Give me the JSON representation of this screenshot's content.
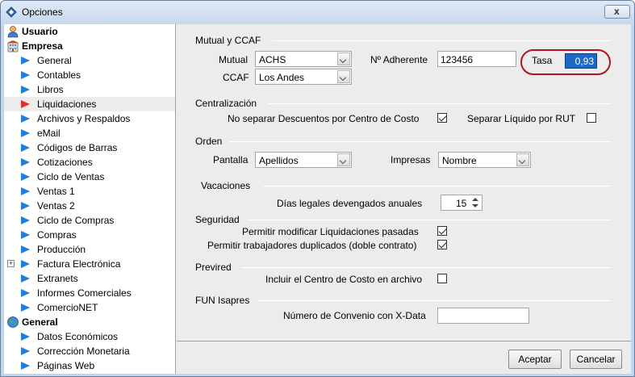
{
  "window": {
    "title": "Opciones",
    "close_label": "x"
  },
  "sidebar": {
    "usuario": "Usuario",
    "empresa": "Empresa",
    "empresa_items": [
      "General",
      "Contables",
      "Libros",
      "Liquidaciones",
      "Archivos y Respaldos",
      "eMail",
      "Códigos de Barras",
      "Cotizaciones",
      "Ciclo de Ventas",
      "Ventas 1",
      "Ventas 2",
      "Ciclo de Compras",
      "Compras",
      "Producción",
      "Factura Electrónica",
      "Extranets",
      "Informes Comerciales",
      "ComercioNET"
    ],
    "general": "General",
    "general_items": [
      "Datos Económicos",
      "Corrección Monetaria",
      "Páginas Web"
    ],
    "selected": "Liquidaciones",
    "expand_symbol": "+"
  },
  "mutual_ccaf": {
    "section": "Mutual y CCAF",
    "mutual_label": "Mutual",
    "mutual_value": "ACHS",
    "ccaf_label": "CCAF",
    "ccaf_value": "Los Andes",
    "adherente_label": "Nº Adherente",
    "adherente_value": "123456",
    "tasa_label": "Tasa",
    "tasa_value": "0,93"
  },
  "centralizacion": {
    "section": "Centralización",
    "no_separar_label": "No separar Descuentos por Centro de Costo",
    "no_separar_checked": true,
    "separar_rut_label": "Separar Líquido por RUT",
    "separar_rut_checked": false
  },
  "orden": {
    "section": "Orden",
    "pantalla_label": "Pantalla",
    "pantalla_value": "Apellidos",
    "impresas_label": "Impresas",
    "impresas_value": "Nombre"
  },
  "vacaciones": {
    "section": "Vacaciones",
    "dias_label": "Días legales devengados anuales",
    "dias_value": "15"
  },
  "seguridad": {
    "section": "Seguridad",
    "permitir_modificar_label": "Permitir modificar Liquidaciones pasadas",
    "permitir_modificar_checked": true,
    "permitir_duplicados_label": "Permitir trabajadores duplicados (doble contrato)",
    "permitir_duplicados_checked": true
  },
  "previred": {
    "section": "Previred",
    "incluir_label": "Incluir el Centro de Costo en archivo",
    "incluir_checked": false
  },
  "fun_isapres": {
    "section": "FUN Isapres",
    "convenio_label": "Número de Convenio con X-Data",
    "convenio_value": ""
  },
  "buttons": {
    "accept": "Aceptar",
    "cancel": "Cancelar"
  },
  "colors": {
    "accent_selection": "#1d69c8",
    "highlight_ring": "#b0141e",
    "tree_arrow": "#1e7fd8",
    "tree_arrow_selected": "#e03030"
  }
}
